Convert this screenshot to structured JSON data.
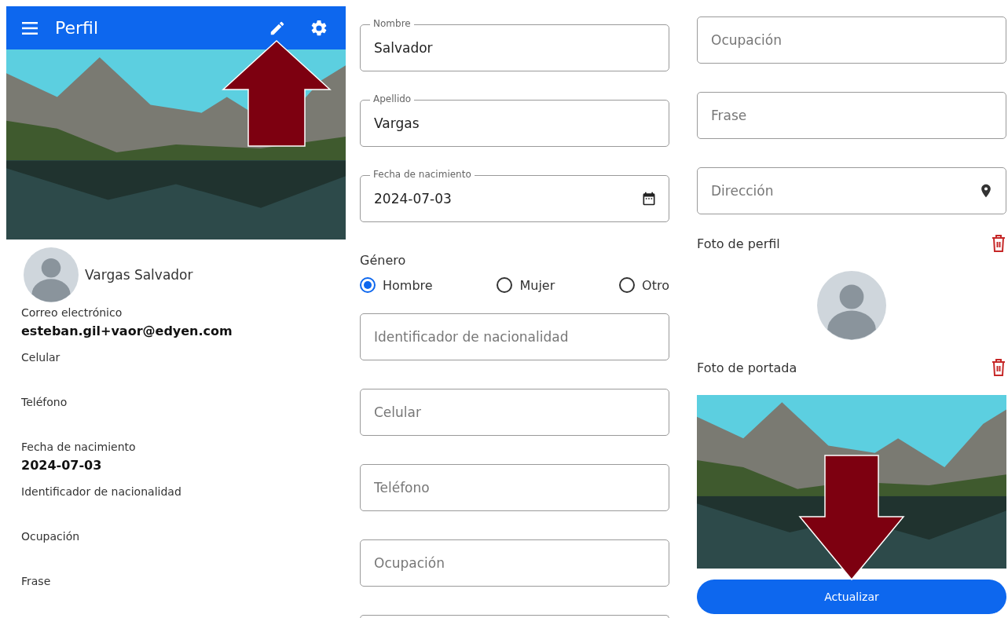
{
  "profile_view": {
    "app_bar": {
      "title": "Perfil"
    },
    "name": "Vargas Salvador",
    "details": [
      {
        "label": "Correo electrónico",
        "value": "esteban.gil+vaor@edyen.com"
      },
      {
        "label": "Celular"
      },
      {
        "label": "Teléfono"
      },
      {
        "label": "Fecha de nacimiento",
        "value": "2024-07-03"
      },
      {
        "label": "Identificador de nacionalidad"
      },
      {
        "label": "Ocupación"
      },
      {
        "label": "Frase"
      }
    ]
  },
  "edit_form": {
    "column_1": [
      {
        "kind": "filled",
        "label": "Nombre",
        "value": "Salvador"
      },
      {
        "kind": "filled",
        "label": "Apellido",
        "value": "Vargas"
      },
      {
        "kind": "date",
        "label": "Fecha de nacimiento",
        "value": "2024-07-03"
      },
      {
        "kind": "radio",
        "label": "Género",
        "options": [
          {
            "label": "Hombre",
            "selected": true
          },
          {
            "label": "Mujer",
            "selected": false
          },
          {
            "label": "Otro",
            "selected": false
          }
        ]
      },
      {
        "kind": "empty",
        "placeholder": "Identificador de nacionalidad"
      },
      {
        "kind": "empty",
        "placeholder": "Celular"
      },
      {
        "kind": "empty",
        "placeholder": "Teléfono"
      },
      {
        "kind": "empty",
        "placeholder": "Ocupación"
      },
      {
        "kind": "cut"
      }
    ],
    "column_2": [
      {
        "kind": "empty",
        "placeholder": "Ocupación"
      },
      {
        "kind": "empty",
        "placeholder": "Frase"
      },
      {
        "kind": "location",
        "placeholder": "Dirección"
      },
      {
        "kind": "avatar",
        "label": "Foto de perfil"
      },
      {
        "kind": "cover",
        "label": "Foto de portada"
      },
      {
        "kind": "button",
        "label": "Actualizar"
      }
    ]
  },
  "annotations": [
    {
      "kind": "arrow_up"
    },
    {
      "kind": "arrow_down"
    }
  ]
}
